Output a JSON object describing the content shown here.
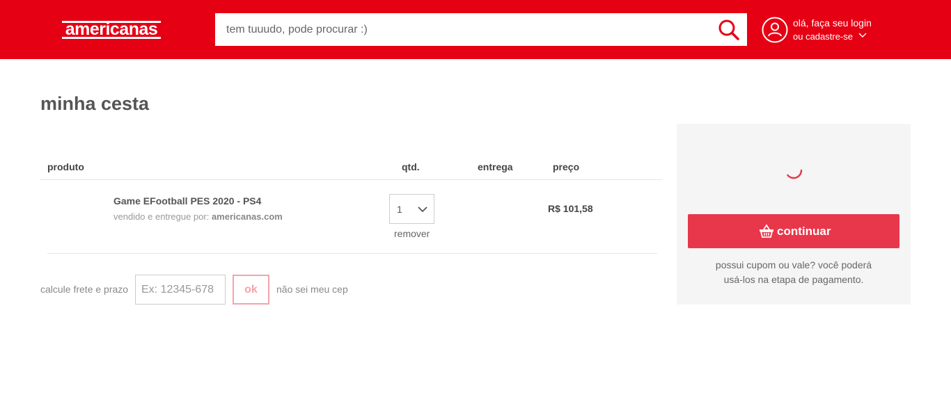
{
  "header": {
    "logo_text": "americanas",
    "search_placeholder": "tem tuuudo, pode procurar :)",
    "account_line1": "olá, faça seu login",
    "account_line2": "ou cadastre-se",
    "brand_color": "#e60014"
  },
  "icons": {
    "search": "search-icon",
    "user": "user-icon",
    "chevron": "chevron-down-icon",
    "basket": "basket-icon",
    "spinner": "loading-spinner-icon"
  },
  "page": {
    "title": "minha cesta"
  },
  "table": {
    "headers": {
      "product": "produto",
      "qty": "qtd.",
      "delivery": "entrega",
      "price": "preço"
    },
    "items": [
      {
        "name": "Game EFootball PES 2020 - PS4",
        "seller_prefix": "vendido e entregue por:",
        "seller": "americanas.com",
        "qty": "1",
        "remove_label": "remover",
        "price": "R$ 101,58"
      }
    ]
  },
  "freight": {
    "label": "calcule frete e prazo",
    "cep_placeholder": "Ex: 12345-678",
    "ok_label": "ok",
    "no_cep_label": "não sei meu cep"
  },
  "summary": {
    "continue_label": "continuar",
    "coupon_line1": "possui cupom ou vale? você poderá",
    "coupon_line2": "usá-los na etapa de pagamento.",
    "button_color": "#e8374a"
  }
}
